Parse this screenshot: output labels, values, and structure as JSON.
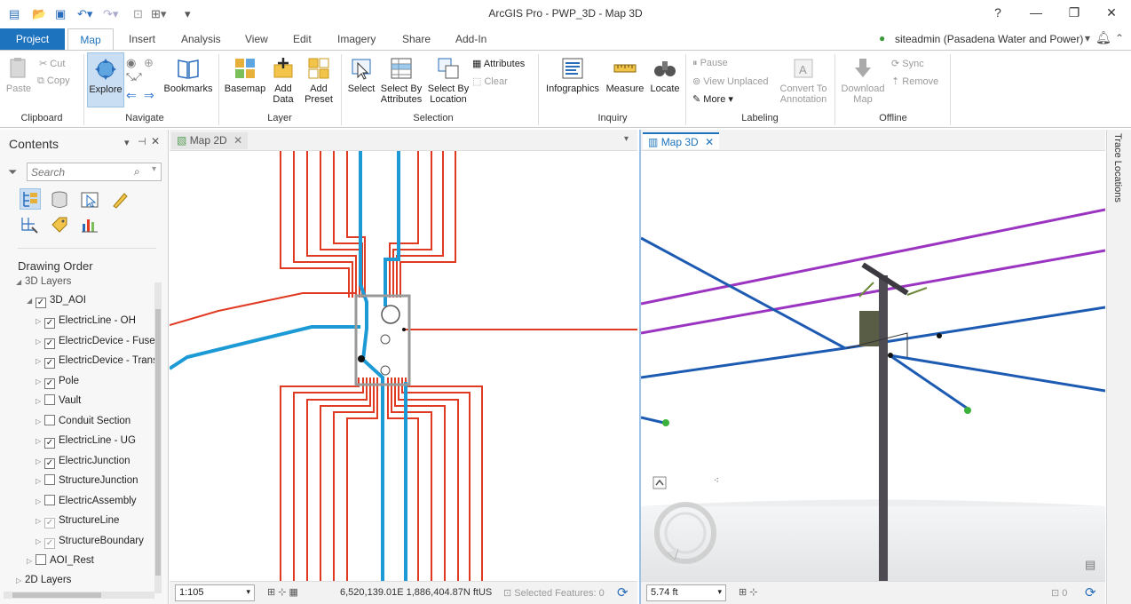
{
  "window": {
    "title": "ArcGIS Pro - PWP_3D - Map 3D",
    "help": "?",
    "minimize": "—",
    "maximize": "❐",
    "close": "✕"
  },
  "tabs": {
    "project": "Project",
    "items": [
      "Map",
      "Insert",
      "Analysis",
      "View",
      "Edit",
      "Imagery",
      "Share",
      "Add-In"
    ],
    "active": "Map"
  },
  "user": "siteadmin (Pasadena Water and Power)",
  "ribbon": {
    "clipboard": {
      "label": "Clipboard",
      "paste": "Paste",
      "cut": "Cut",
      "copy": "Copy"
    },
    "navigate": {
      "label": "Navigate",
      "explore": "Explore",
      "bookmarks": "Bookmarks"
    },
    "layer": {
      "label": "Layer",
      "basemap": "Basemap",
      "add_data_1": "Add",
      "add_data_2": "Data",
      "add_preset_1": "Add",
      "add_preset_2": "Preset"
    },
    "selection": {
      "label": "Selection",
      "select": "Select",
      "select_by_attr_1": "Select By",
      "select_by_attr_2": "Attributes",
      "select_by_loc_1": "Select By",
      "select_by_loc_2": "Location",
      "attributes": "Attributes",
      "clear": "Clear"
    },
    "inquiry": {
      "label": "Inquiry",
      "infographics": "Infographics",
      "measure": "Measure",
      "locate": "Locate"
    },
    "labeling": {
      "label": "Labeling",
      "pause": "Pause",
      "view_unplaced": "View Unplaced",
      "more": "More",
      "convert_1": "Convert To",
      "convert_2": "Annotation"
    },
    "offline": {
      "label": "Offline",
      "download_1": "Download",
      "download_2": "Map",
      "sync": "Sync",
      "remove": "Remove"
    }
  },
  "contents": {
    "title": "Contents",
    "search_placeholder": "Search",
    "drawing_order": "Drawing Order",
    "group_3d": "3D Layers",
    "group_aoi": "3D_AOI",
    "layers": [
      {
        "name": "ElectricLine - OH",
        "checked": true
      },
      {
        "name": "ElectricDevice - Fuse-",
        "checked": true
      },
      {
        "name": "ElectricDevice - Trans",
        "checked": true
      },
      {
        "name": "Pole",
        "checked": true
      },
      {
        "name": "Vault",
        "checked": false
      },
      {
        "name": "Conduit Section",
        "checked": false
      },
      {
        "name": "ElectricLine - UG",
        "checked": true
      },
      {
        "name": "ElectricJunction",
        "checked": true
      },
      {
        "name": "StructureJunction",
        "checked": false
      },
      {
        "name": "ElectricAssembly",
        "checked": false
      },
      {
        "name": "StructureLine",
        "checked": true
      },
      {
        "name": "StructureBoundary",
        "checked": true
      }
    ],
    "aoi_rest": "AOI_Rest",
    "group_2d": "2D Layers"
  },
  "map2d": {
    "tab": "Map 2D",
    "scale": "1:105",
    "coords": "6,520,139.01E 1,886,404.87N ftUS",
    "selected": "Selected Features: 0"
  },
  "map3d": {
    "tab": "Map 3D",
    "scale": "5.74 ft",
    "selected": "0"
  },
  "side_panel": "Trace Locations",
  "colors": {
    "accent": "#1e73be",
    "line_red": "#e03a22",
    "line_blue": "#1c9ad6",
    "line_purple": "#9b35c1",
    "line_dark_blue": "#1d5bb3"
  }
}
